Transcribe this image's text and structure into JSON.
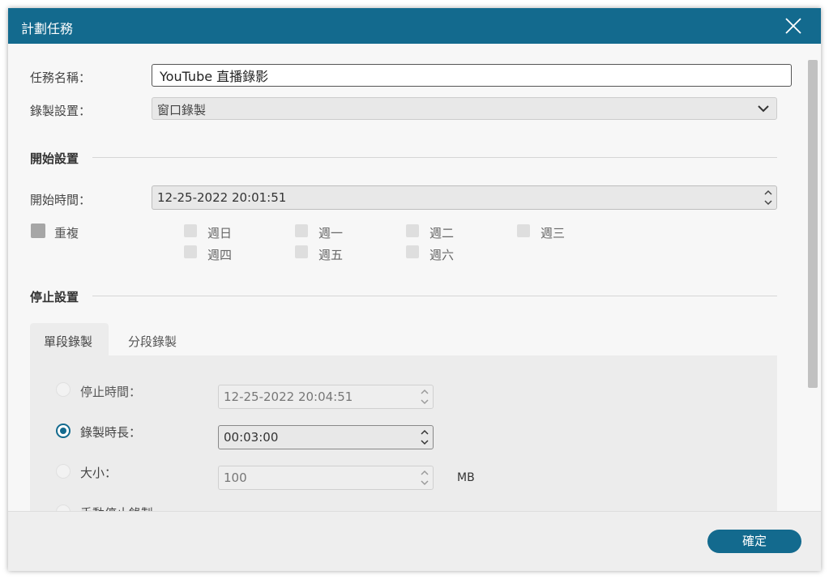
{
  "window": {
    "title": "計劃任務"
  },
  "task": {
    "name_label": "任務名稱：",
    "name_value": "YouTube 直播錄影",
    "record_label": "錄製設置：",
    "record_value": "窗口錄製"
  },
  "start_section": {
    "title": "開始設置",
    "time_label": "開始時間：",
    "time_value": "12-25-2022 20:01:51",
    "repeat_label": "重複",
    "days": [
      "週日",
      "週一",
      "週二",
      "週三",
      "週四",
      "週五",
      "週六"
    ]
  },
  "stop_section": {
    "title": "停止設置",
    "tabs": [
      "單段錄製",
      "分段錄製"
    ],
    "stop_time_label": "停止時間：",
    "stop_time_value": "12-25-2022 20:04:51",
    "duration_label": "錄製時長：",
    "duration_value": "00:03:00",
    "size_label": "大小：",
    "size_value": "100",
    "size_unit": "MB",
    "manual_label": "手動停止錄製"
  },
  "footer": {
    "ok_label": "確定"
  },
  "colors": {
    "accent": "#136a8e",
    "background": "#f7f7f7"
  },
  "icons": {
    "close": "close-icon",
    "dropdown": "chevron-down-icon",
    "spinner": "spinner-arrows-icon"
  }
}
